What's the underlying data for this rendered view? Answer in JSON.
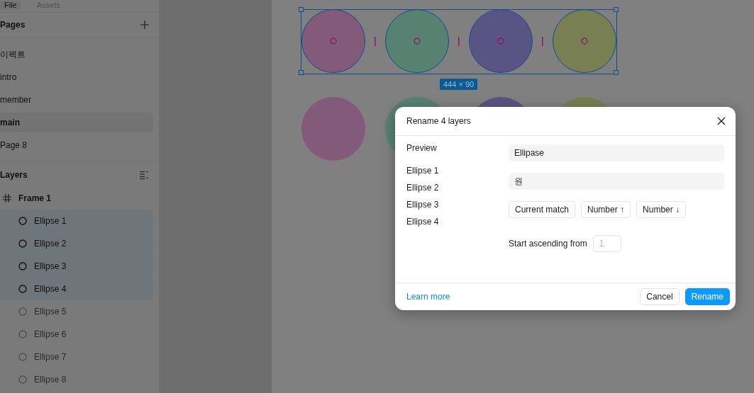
{
  "sidebar": {
    "tabs": [
      {
        "label": "File",
        "selected": true
      },
      {
        "label": "Assets",
        "selected": false
      }
    ],
    "pages": {
      "title": "Pages",
      "items": [
        {
          "label": "이펙트",
          "selected": false
        },
        {
          "label": "intro",
          "selected": false
        },
        {
          "label": "member",
          "selected": false
        },
        {
          "label": "main",
          "selected": true
        },
        {
          "label": "Page 8",
          "selected": false
        }
      ]
    },
    "layers": {
      "title": "Layers",
      "items": [
        {
          "label": "Frame 1",
          "children": [
            {
              "label": "Ellipse 1",
              "selected": true
            },
            {
              "label": "Ellipse 2",
              "selected": true
            },
            {
              "label": "Ellipse 3",
              "selected": true
            },
            {
              "label": "Ellipse 4",
              "selected": true
            },
            {
              "label": "Ellipse 5",
              "selected": false
            },
            {
              "label": "Ellipse 6",
              "selected": false
            },
            {
              "label": "Ellipse 7",
              "selected": false
            },
            {
              "label": "Ellipse 8",
              "selected": false
            }
          ]
        }
      ]
    }
  },
  "canvas": {
    "size_label": "444 × 90",
    "shapes": [
      {
        "color": "#845a7a",
        "selected": true
      },
      {
        "color": "#578272",
        "selected": true
      },
      {
        "color": "#5a5484",
        "selected": true
      },
      {
        "color": "#787f52",
        "selected": true
      },
      {
        "color": "#845a7a",
        "selected": false
      },
      {
        "color": "#578272",
        "selected": false
      },
      {
        "color": "#5a5484",
        "selected": false
      },
      {
        "color": "#787f52",
        "selected": false
      }
    ]
  },
  "dialog": {
    "title": "Rename 4 layers",
    "preview_label": "Preview",
    "preview_items": [
      "Ellipse 1",
      "Ellipse 2",
      "Ellipse 3",
      "Ellipse 4"
    ],
    "find_value": "Ellipase",
    "replace_value": "원",
    "options": [
      "Current match",
      "Number ↑",
      "Number ↓"
    ],
    "start_label": "Start ascending from",
    "start_placeholder": "1",
    "learn_more": "Learn more",
    "cancel": "Cancel",
    "confirm": "Rename"
  }
}
